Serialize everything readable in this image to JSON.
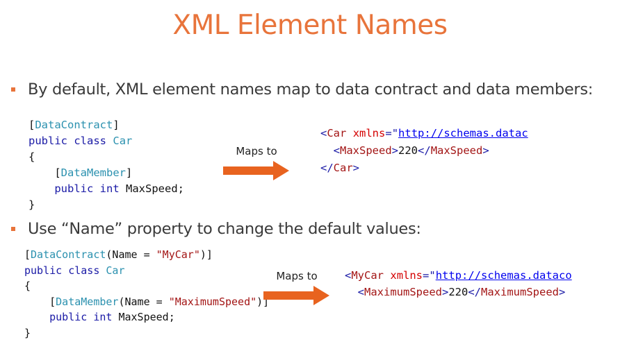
{
  "slide": {
    "title": "XML Element Names",
    "bullets": [
      "By default, XML element names map to data contract and data members:",
      "Use “Name” property to change the default values:"
    ],
    "arrow_label": "Maps to",
    "colors": {
      "accent": "#e8743b",
      "keyword": "#1a1aa6",
      "type": "#2b91af",
      "string": "#a31515",
      "attribute": "#d40000",
      "link": "#0000ee"
    }
  },
  "example1": {
    "code": {
      "lb": "[",
      "attr": "DataContract",
      "rb": "]",
      "kw_public": "public",
      "kw_class": "class",
      "class_name": "Car",
      "open_brace": "{",
      "lb2": "[",
      "attr2": "DataMember",
      "rb2": "]",
      "kw_public2": "public",
      "kw_int": "int",
      "prop": "MaxSpeed;",
      "close_brace": "}"
    },
    "xml": {
      "lt1": "<",
      "tag1": "Car",
      "attr_name": "xmlns",
      "eq_quote": "=\"",
      "url": "http://schemas.datac",
      "lt2": "<",
      "tag2": "MaxSpeed",
      "gt2": ">",
      "value": "220",
      "close2_lt": "</",
      "close2_tag": "MaxSpeed",
      "close2_gt": ">",
      "close1_lt": "</",
      "close1_tag": "Car",
      "close1_gt": ">"
    }
  },
  "example2": {
    "code": {
      "lb": "[",
      "attr": "DataContract",
      "args_open": "(Name = ",
      "name_str": "\"MyCar\"",
      "args_close": ")]",
      "kw_public": "public",
      "kw_class": "class",
      "class_name": "Car",
      "open_brace": "{",
      "lb2": "[",
      "attr2": "DataMember",
      "args2_open": "(Name = ",
      "name2_str": "\"MaximumSpeed\"",
      "args2_close": ")]",
      "kw_public2": "public",
      "kw_int": "int",
      "prop": "MaxSpeed;",
      "close_brace": "}"
    },
    "xml": {
      "lt1": "<",
      "tag1": "MyCar",
      "attr_name": "xmlns",
      "eq_quote": "=\"",
      "url": "http://schemas.dataco",
      "lt2": "<",
      "tag2": "MaximumSpeed",
      "gt2": ">",
      "value": "220",
      "close2_lt": "</",
      "close2_tag": "MaximumSpeed",
      "close2_gt": ">"
    }
  }
}
